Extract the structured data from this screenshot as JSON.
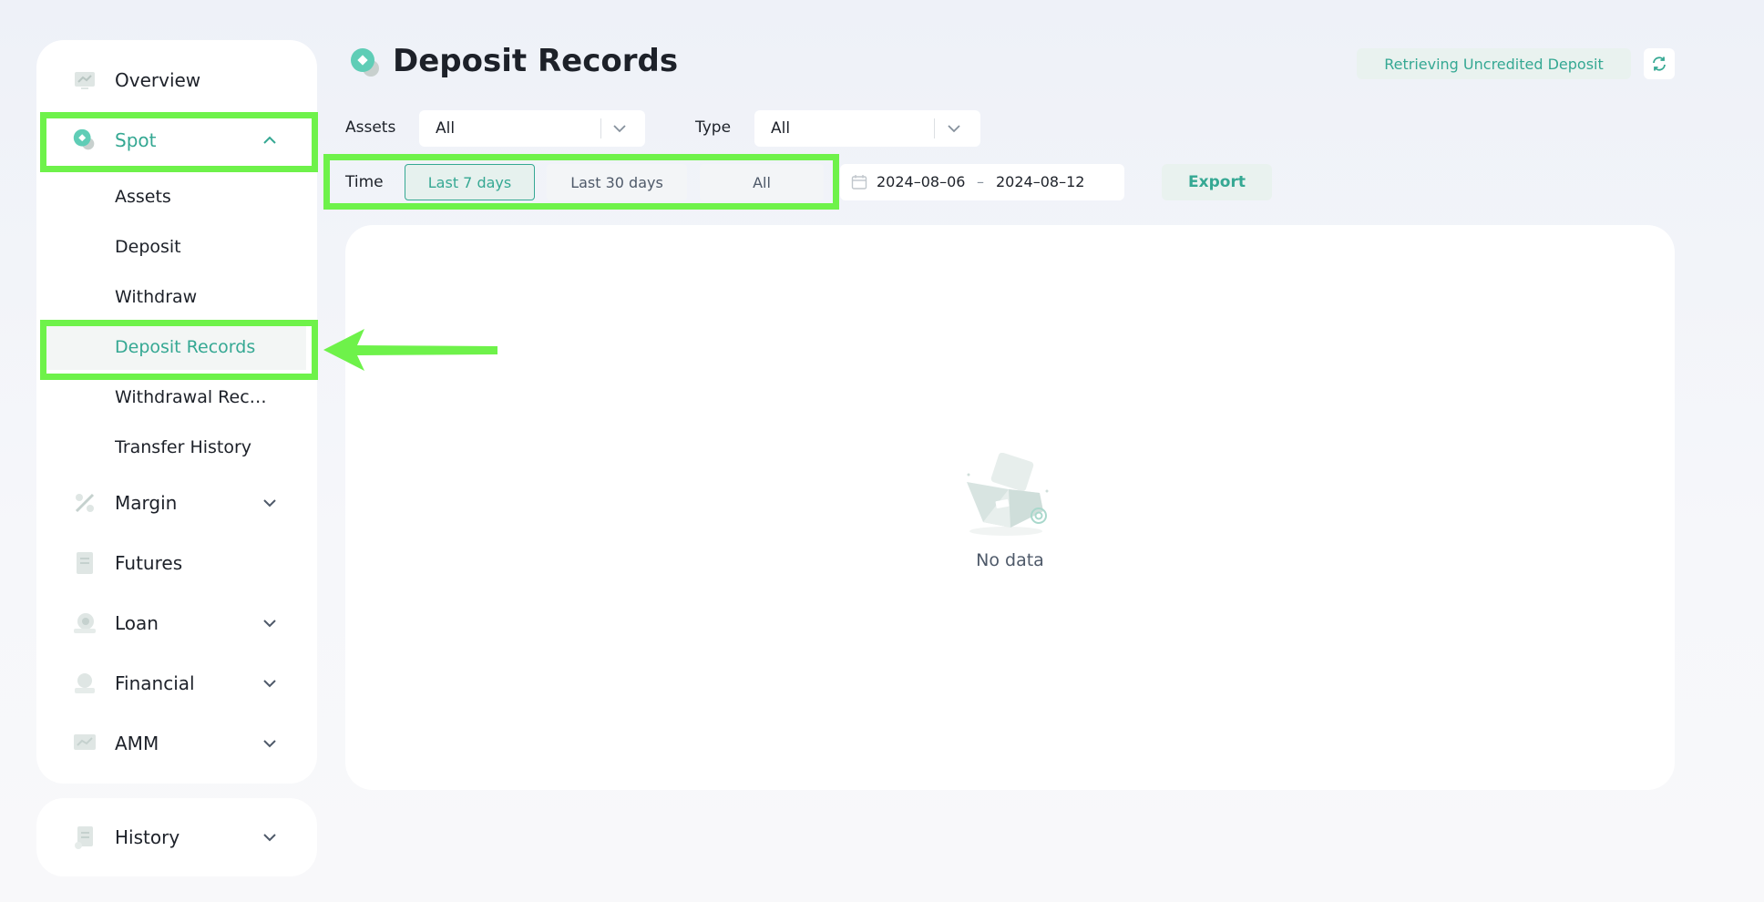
{
  "sidebar": {
    "overview": "Overview",
    "spot": "Spot",
    "spot_sub": [
      "Assets",
      "Deposit",
      "Withdraw",
      "Deposit Records",
      "Withdrawal Reco...",
      "Transfer History"
    ],
    "margin": "Margin",
    "futures": "Futures",
    "loan": "Loan",
    "financial": "Financial",
    "amm": "AMM",
    "history": "History"
  },
  "header": {
    "title": "Deposit Records",
    "retrieve_label": "Retrieving Uncredited Deposit"
  },
  "filters": {
    "assets_label": "Assets",
    "assets_value": "All",
    "type_label": "Type",
    "type_value": "All",
    "time_label": "Time",
    "time_options": [
      "Last 7 days",
      "Last 30 days",
      "All"
    ],
    "time_selected": "Last 7 days",
    "date_start": "2024–08–06",
    "date_sep": "–",
    "date_end": "2024–08–12",
    "export_label": "Export"
  },
  "content": {
    "empty_text": "No data"
  },
  "colors": {
    "accent": "#35a893",
    "highlight": "#6ef24a"
  }
}
